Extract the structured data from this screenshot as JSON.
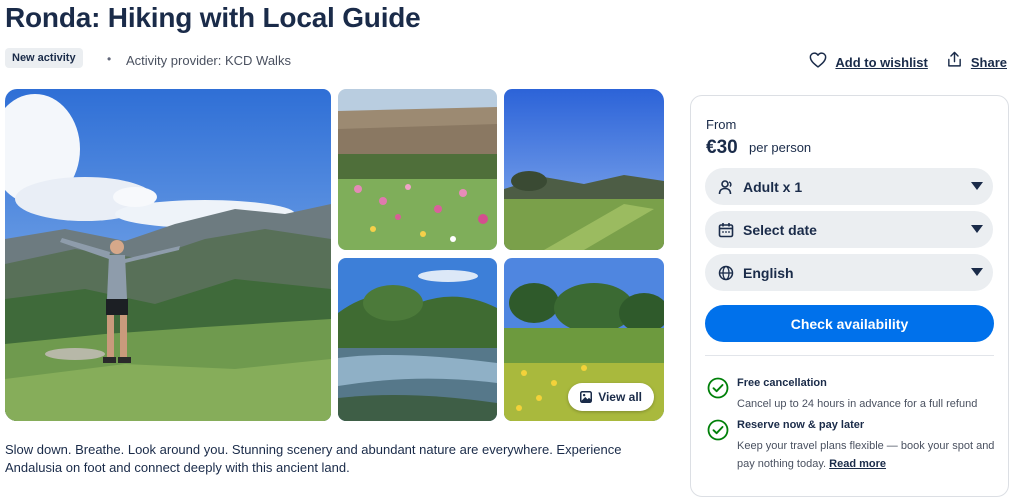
{
  "page": {
    "title": "Ronda: Hiking with Local Guide"
  },
  "meta": {
    "badge": "New activity",
    "separator": "•",
    "provider": "Activity provider: KCD Walks"
  },
  "actions": {
    "wishlist": "Add to wishlist",
    "share": "Share"
  },
  "gallery": {
    "view_all": "View all"
  },
  "description": "Slow down. Breathe. Look around you. Stunning scenery and abundant nature are everywhere. Experience Andalusia on foot and connect deeply with this ancient land.",
  "booking": {
    "from_label": "From",
    "price": "€30",
    "price_unit": "per person",
    "participants": "Adult x 1",
    "date": "Select date",
    "language": "English",
    "cta": "Check availability",
    "features": [
      {
        "title": "Free cancellation",
        "desc": "Cancel up to 24 hours in advance for a full refund"
      },
      {
        "title": "Reserve now & pay later",
        "desc": "Keep your travel plans flexible — book your spot and pay nothing today.",
        "link": "Read more"
      }
    ]
  },
  "colors": {
    "accent": "#0071eb",
    "text": "#1a2b49",
    "check": "#008009"
  }
}
